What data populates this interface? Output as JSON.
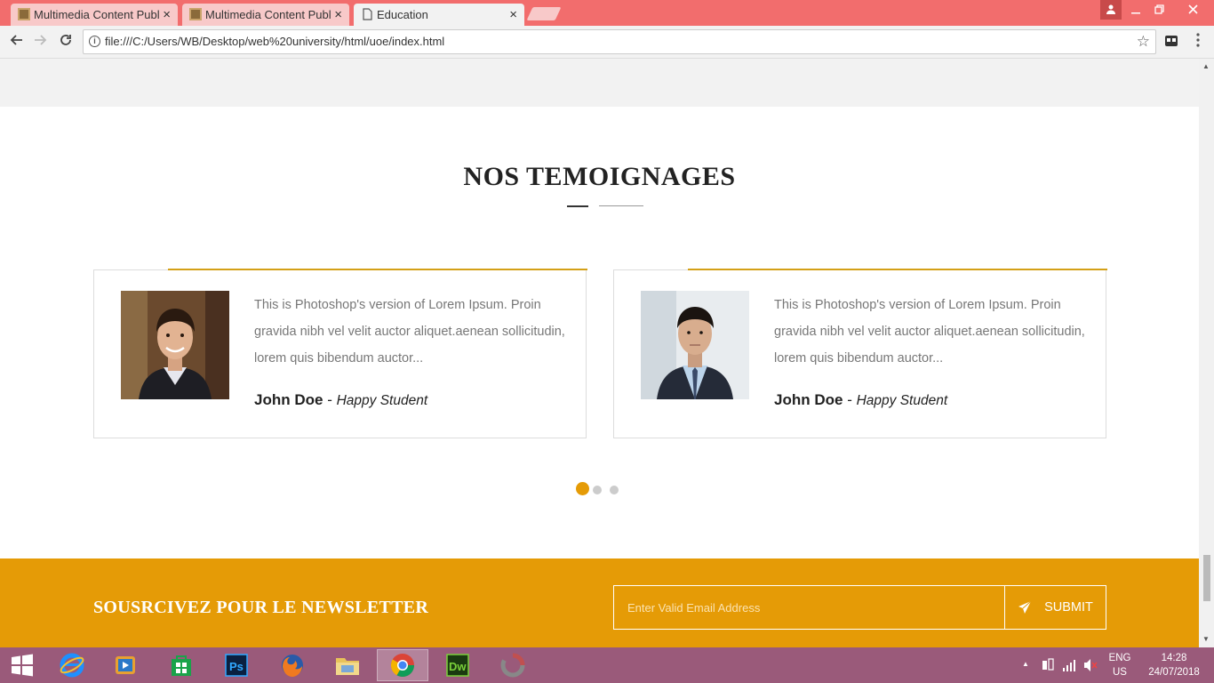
{
  "browser": {
    "tabs": [
      {
        "title": "Multimedia Content Publ",
        "active": false
      },
      {
        "title": "Multimedia Content Publ",
        "active": false
      },
      {
        "title": "Education",
        "active": true
      }
    ],
    "url": "file:///C:/Users/WB/Desktop/web%20university/html/uoe/index.html",
    "close_glyph": "×"
  },
  "testimonials": {
    "title": "NOS TEMOIGNAGES",
    "cards": [
      {
        "quote": "This is Photoshop's version of Lorem Ipsum. Proin gravida nibh vel velit auctor aliquet.aenean sollicitudin, lorem quis bibendum auctor...",
        "name": "John Doe",
        "role": "Happy Student",
        "photo_icon": "smiling-man-photo"
      },
      {
        "quote": "This is Photoshop's version of Lorem Ipsum. Proin gravida nibh vel velit auctor aliquet.aenean sollicitudin, lorem quis bibendum auctor...",
        "name": "John Doe",
        "role": "Happy Student",
        "photo_icon": "businessman-photo"
      }
    ],
    "pagination": {
      "pages": 3,
      "current": 1
    }
  },
  "newsletter": {
    "title": "SOUSRCIVEZ POUR LE NEWSLETTER",
    "placeholder": "Enter Valid Email Address",
    "submit_label": "SUBMIT"
  },
  "taskbar": {
    "lang": "ENG",
    "region": "US",
    "time": "14:28",
    "date": "24/07/2018"
  },
  "colors": {
    "accent": "#e59b06",
    "tabbar": "#f26d6d",
    "taskbar": "#9a5a7a",
    "card_border_accent": "#d4a017"
  }
}
